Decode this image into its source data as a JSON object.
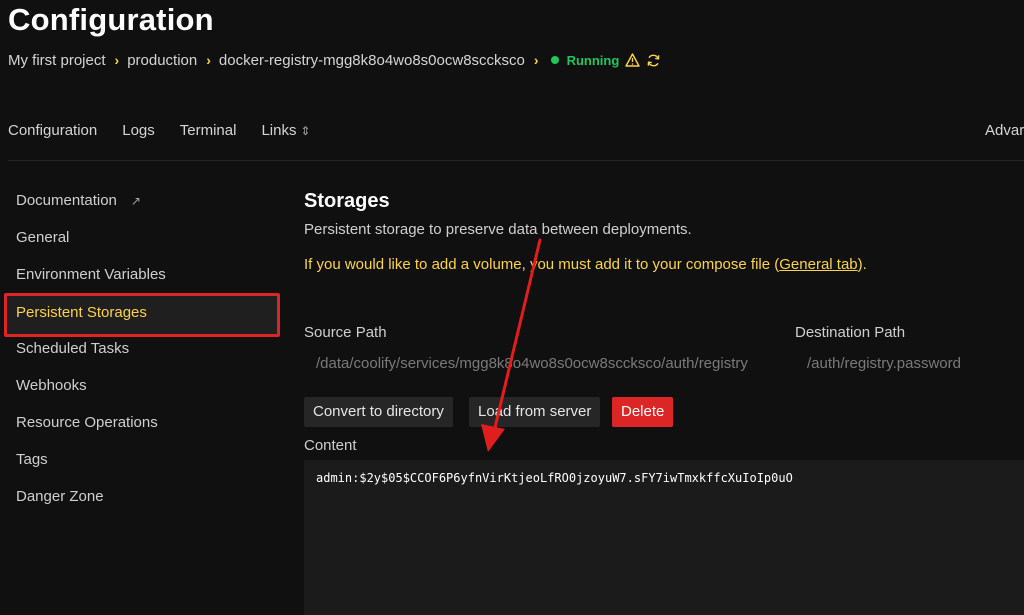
{
  "page_title": "Configuration",
  "breadcrumb": {
    "project": "My first project",
    "environment": "production",
    "resource": "docker-registry-mgg8k8o4wo8s0ocw8sccksco",
    "status": "Running"
  },
  "tabs": {
    "configuration": "Configuration",
    "logs": "Logs",
    "terminal": "Terminal",
    "links": "Links",
    "advanced": "Advar"
  },
  "sidebar": {
    "items": [
      {
        "label": "Documentation"
      },
      {
        "label": "General"
      },
      {
        "label": "Environment Variables"
      },
      {
        "label": "Persistent Storages"
      },
      {
        "label": "Scheduled Tasks"
      },
      {
        "label": "Webhooks"
      },
      {
        "label": "Resource Operations"
      },
      {
        "label": "Tags"
      },
      {
        "label": "Danger Zone"
      }
    ],
    "active_index": 3
  },
  "storages": {
    "title": "Storages",
    "subtitle": "Persistent storage to preserve data between deployments.",
    "warning_prefix": "If you would like to add a volume, you must add it to your compose file (",
    "warning_link": "General tab",
    "warning_suffix": ").",
    "source_path_label": "Source Path",
    "source_path_value": "/data/coolify/services/mgg8k8o4wo8s0ocw8sccksco/auth/registry",
    "destination_path_label": "Destination Path",
    "destination_path_value": "/auth/registry.password",
    "buttons": {
      "convert": "Convert to directory",
      "load": "Load from server",
      "delete": "Delete"
    },
    "content_label": "Content",
    "content_value": "admin:$2y$05$CCOF6P6yfnVirKtjeoLfRO0jzoyuW7.sFY7iwTmxkffcXuIoIp0uO"
  },
  "colors": {
    "accent": "#fcd34d",
    "running": "#22c55e",
    "danger": "#dc2626",
    "highlight_box": "#dc2626",
    "arrow": "#e11d1d"
  },
  "icons": [
    "chevron-right-icon",
    "warning-icon",
    "refresh-icon",
    "chevron-updown-icon",
    "external-link-icon"
  ]
}
